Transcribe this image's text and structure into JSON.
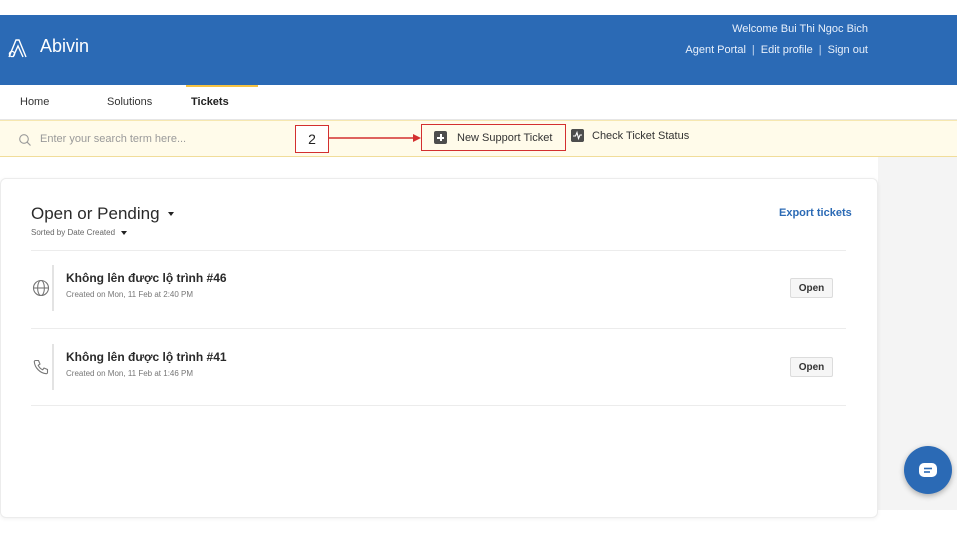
{
  "header": {
    "brand": "Abivin",
    "welcome": "Welcome Bui Thi Ngoc Bich",
    "links": [
      "Agent Portal",
      "Edit profile",
      "Sign out"
    ],
    "separator": "|",
    "background": "#2b6ab5"
  },
  "nav": {
    "items": [
      "Home",
      "Solutions",
      "Tickets"
    ],
    "active": "Tickets"
  },
  "search": {
    "placeholder": "Enter your search term here...",
    "value": ""
  },
  "annotation": {
    "label": "2",
    "color": "#d32f2f"
  },
  "actions": {
    "new_ticket": "New Support Ticket",
    "check_status": "Check Ticket Status"
  },
  "list": {
    "title": "Open or Pending",
    "sort": "Sorted by Date Created",
    "export": "Export tickets",
    "tickets": [
      {
        "title": "Không lên được lộ trình #46",
        "created": "Created on Mon, 11 Feb at 2:40 PM",
        "status": "Open",
        "icon": "globe-icon"
      },
      {
        "title": "Không lên được lộ trình #41",
        "created": "Created on Mon, 11 Feb at 1:46 PM",
        "status": "Open",
        "icon": "phone-icon"
      }
    ]
  },
  "chat": {
    "icon": "chat-icon"
  }
}
